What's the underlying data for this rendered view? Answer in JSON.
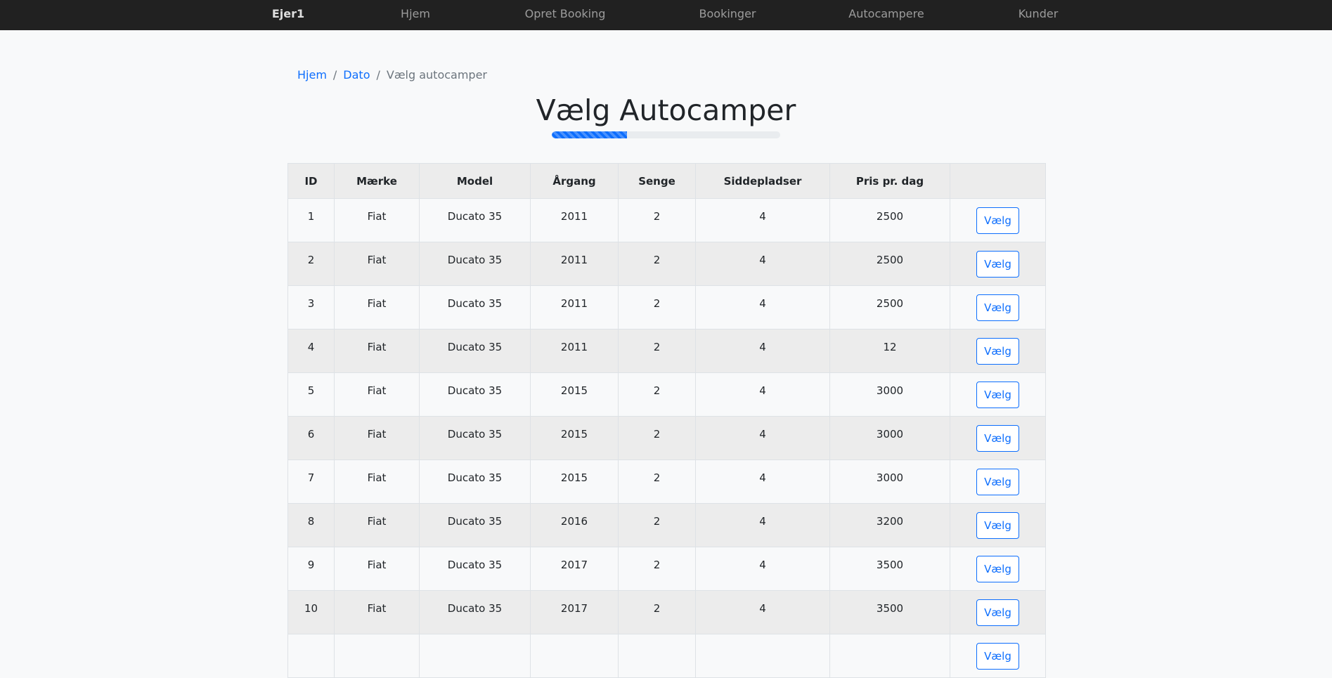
{
  "nav": {
    "brand": "Ejer1",
    "items": [
      "Hjem",
      "Opret Booking",
      "Bookinger",
      "Autocampere",
      "Kunder"
    ]
  },
  "breadcrumb": {
    "items": [
      "Hjem",
      "Dato"
    ],
    "current": "Vælg autocamper"
  },
  "page": {
    "title": "Vælg Autocamper",
    "progress_percent": 33
  },
  "table": {
    "headers": [
      "ID",
      "Mærke",
      "Model",
      "Årgang",
      "Senge",
      "Siddepladser",
      "Pris pr. dag",
      ""
    ],
    "rows": [
      [
        "1",
        "Fiat",
        "Ducato 35",
        "2011",
        "2",
        "4",
        "2500"
      ],
      [
        "2",
        "Fiat",
        "Ducato 35",
        "2011",
        "2",
        "4",
        "2500"
      ],
      [
        "3",
        "Fiat",
        "Ducato 35",
        "2011",
        "2",
        "4",
        "2500"
      ],
      [
        "4",
        "Fiat",
        "Ducato 35",
        "2011",
        "2",
        "4",
        "12"
      ],
      [
        "5",
        "Fiat",
        "Ducato 35",
        "2015",
        "2",
        "4",
        "3000"
      ],
      [
        "6",
        "Fiat",
        "Ducato 35",
        "2015",
        "2",
        "4",
        "3000"
      ],
      [
        "7",
        "Fiat",
        "Ducato 35",
        "2015",
        "2",
        "4",
        "3000"
      ],
      [
        "8",
        "Fiat",
        "Ducato 35",
        "2016",
        "2",
        "4",
        "3200"
      ],
      [
        "9",
        "Fiat",
        "Ducato 35",
        "2017",
        "2",
        "4",
        "3500"
      ],
      [
        "10",
        "Fiat",
        "Ducato 35",
        "2017",
        "2",
        "4",
        "3500"
      ],
      [
        "",
        "",
        "",
        "",
        "",
        "",
        ""
      ]
    ],
    "action_label": "Vælg"
  },
  "colors": {
    "navbar": "#212121",
    "accent": "#0d6efd",
    "page_background": "#f8f9fa"
  }
}
